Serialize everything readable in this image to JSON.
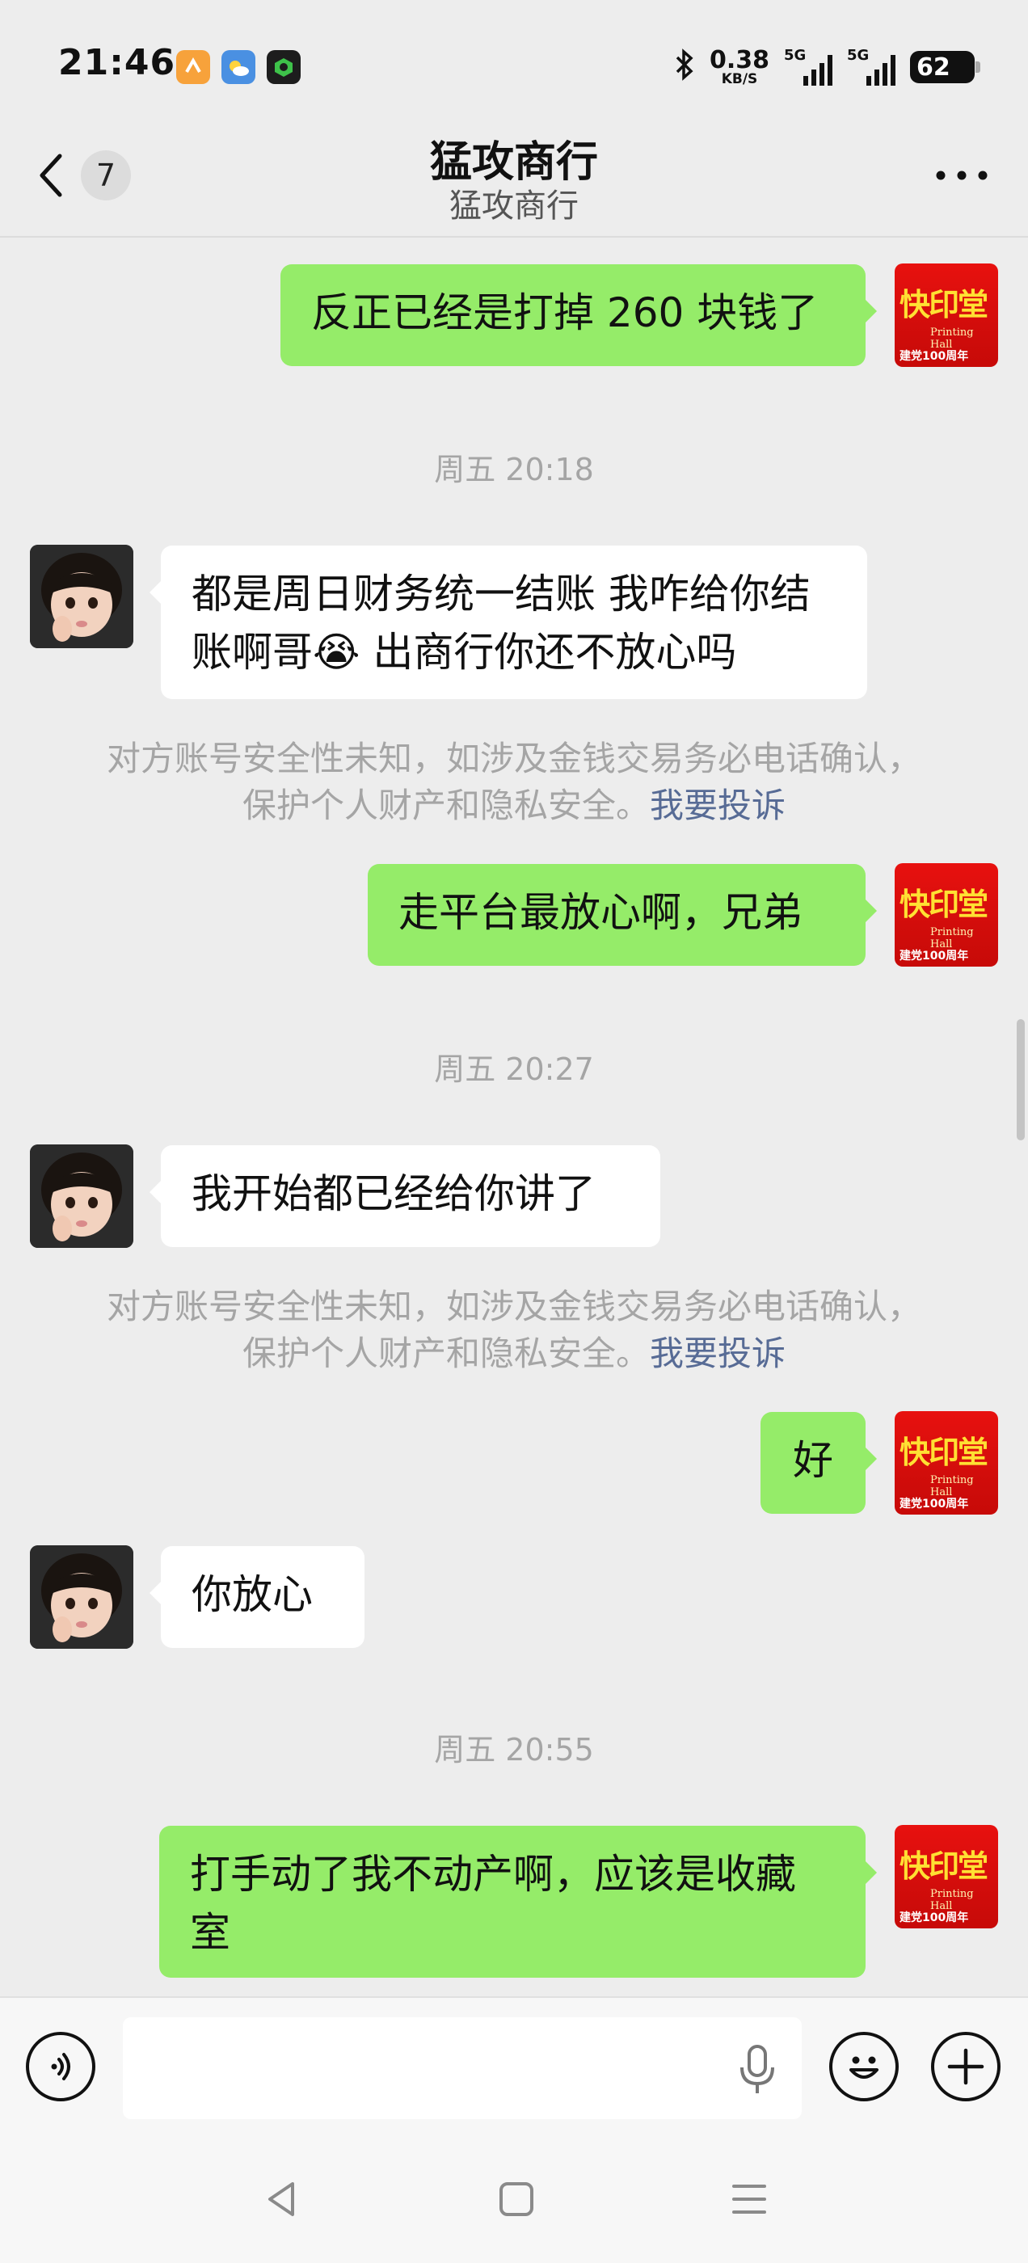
{
  "status_bar": {
    "time": "21:46",
    "net_speed_value": "0.38",
    "net_speed_unit": "KB/S",
    "signal_1_label": "5G",
    "signal_2_label": "5G",
    "battery": "62"
  },
  "header": {
    "unread_count": "7",
    "title": "猛攻商行",
    "subtitle": "猛攻商行"
  },
  "messages": [
    {
      "side": "me",
      "text": "反正已经是打掉 260 块钱了"
    },
    {
      "time": "周五 20:18"
    },
    {
      "side": "them",
      "text_line1": "都是周日财务统一结账 我咋给你结",
      "text_line2_a": "账啊哥",
      "emoji": "😭",
      "text_line2_b": " 出商行你还不放心吗"
    },
    {
      "warning_line1": "对方账号安全性未知，如涉及金钱交易务必电话确认，",
      "warning_line2": "保护个人财产和隐私安全。",
      "warning_link": "我要投诉"
    },
    {
      "side": "me",
      "text": "走平台最放心啊，兄弟"
    },
    {
      "time": "周五 20:27"
    },
    {
      "side": "them",
      "text": "我开始都已经给你讲了"
    },
    {
      "warning_line1": "对方账号安全性未知，如涉及金钱交易务必电话确认，",
      "warning_line2": "保护个人财产和隐私安全。",
      "warning_link": "我要投诉"
    },
    {
      "side": "me",
      "text": "好"
    },
    {
      "side": "them",
      "text": "你放心"
    },
    {
      "time": "周五 20:55"
    },
    {
      "side": "me",
      "text_line1": "打手动了我不动产啊，应该是收藏",
      "text_line2": "室"
    }
  ],
  "my_avatar": {
    "big_text": "快印堂",
    "small_text": "Printing Hall",
    "bottom_text": "建党100周年"
  },
  "input_bar": {
    "placeholder": ""
  },
  "colors": {
    "my_bubble": "#95ec69",
    "their_bubble": "#ffffff",
    "link": "#576b95",
    "background": "#ededed"
  }
}
